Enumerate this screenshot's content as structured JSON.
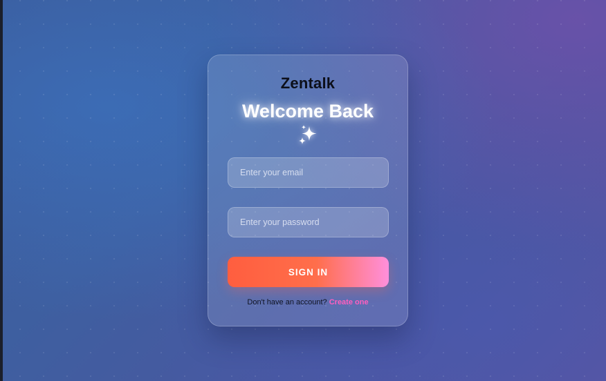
{
  "card": {
    "brand": "Zentalk",
    "title": "Welcome Back",
    "sparkle_icon": "sparkles-icon"
  },
  "form": {
    "email_placeholder": "Enter your email",
    "password_placeholder": "Enter your password",
    "submit_label": "SIGN IN"
  },
  "footer": {
    "prompt": "Don't have an account?",
    "link_label": "Create one"
  },
  "colors": {
    "button_gradient_start": "#ff5e3f",
    "button_gradient_end": "#ff8fdc",
    "link": "#ff5fbf"
  }
}
